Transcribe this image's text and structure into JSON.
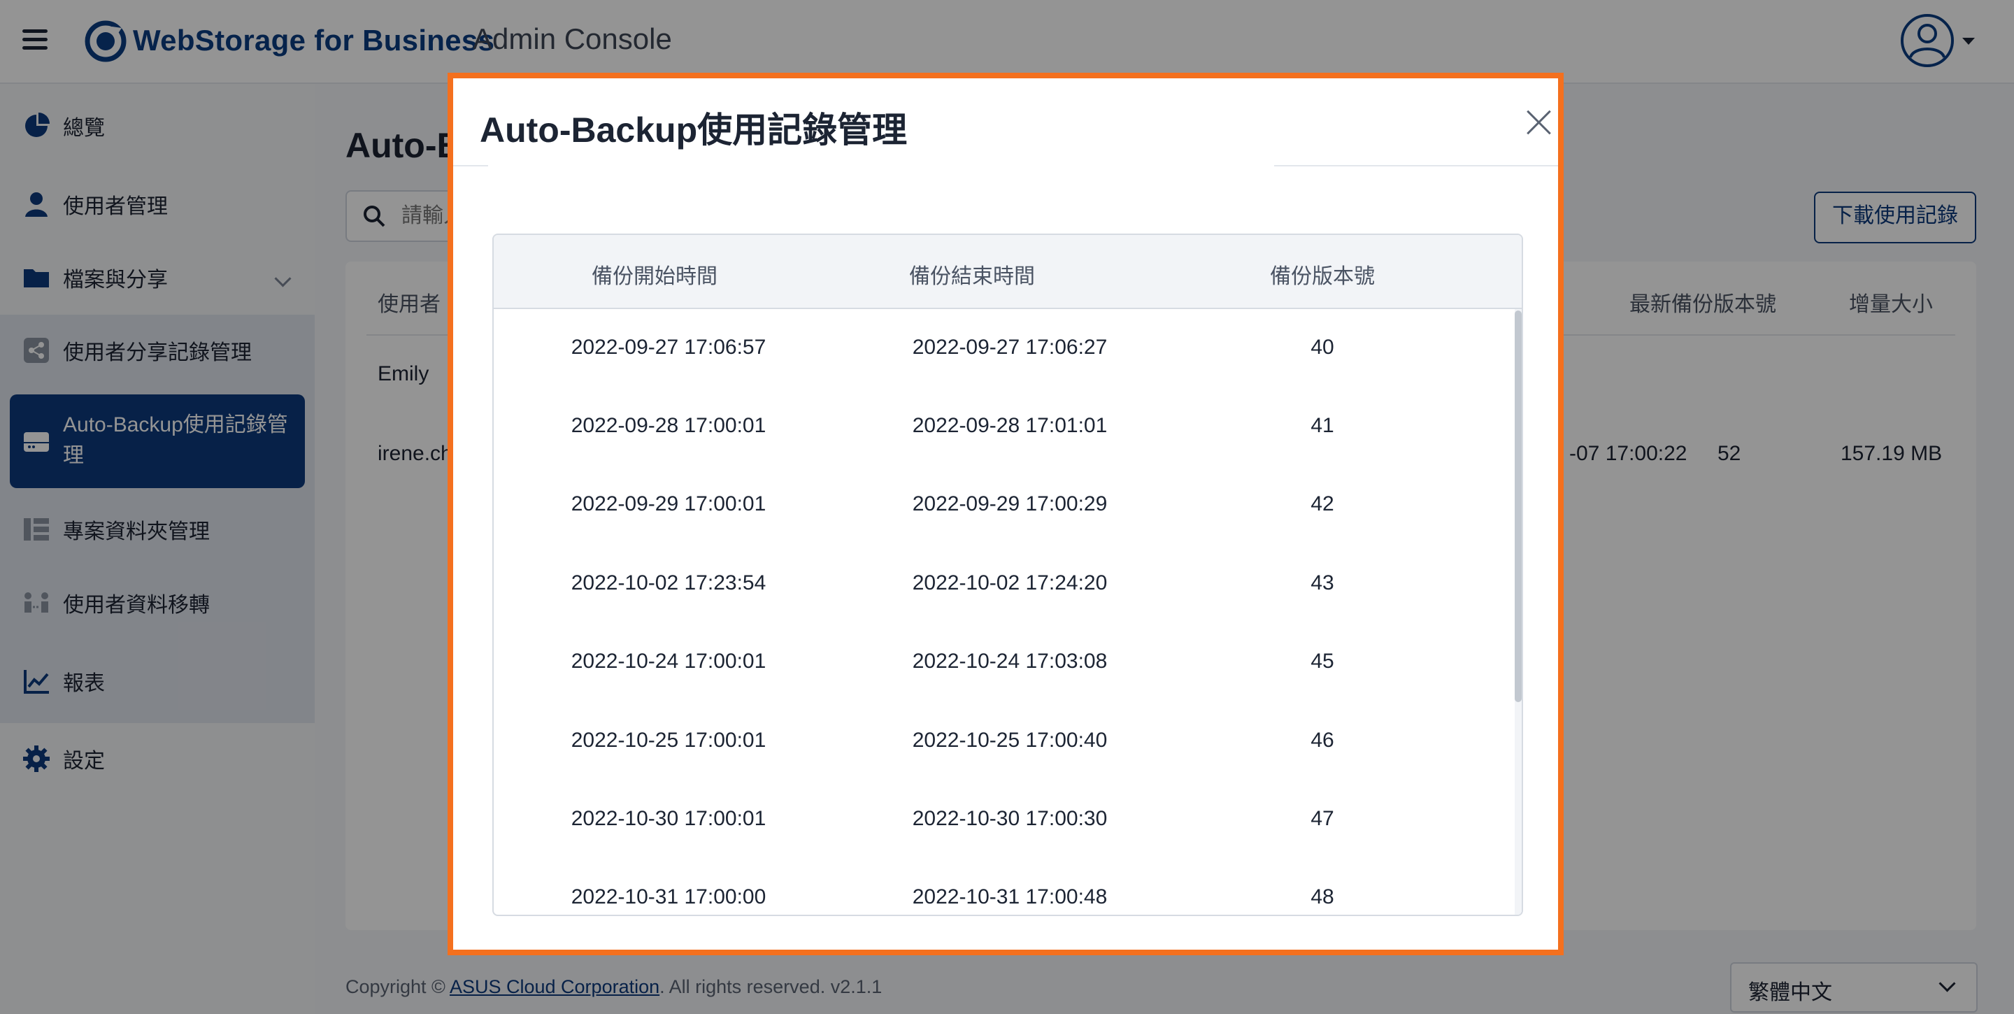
{
  "header": {
    "brand_name": "WebStorage for Business",
    "brand_sub": "Admin Console",
    "brand_color": "#0c3d82"
  },
  "sidebar": {
    "items": [
      {
        "label": "總覽",
        "icon": "pie-chart-icon"
      },
      {
        "label": "使用者管理",
        "icon": "user-icon"
      },
      {
        "label": "檔案與分享",
        "icon": "folder-icon"
      },
      {
        "label": "使用者分享記錄管理",
        "icon": "share-icon"
      },
      {
        "label": "Auto-Backup使用記錄管理",
        "icon": "backup-drive-icon",
        "active": true
      },
      {
        "label": "專案資料夾管理",
        "icon": "project-folder-icon"
      },
      {
        "label": "使用者資料移轉",
        "icon": "transfer-icon"
      },
      {
        "label": "報表",
        "icon": "line-chart-icon"
      },
      {
        "label": "設定",
        "icon": "gear-icon"
      }
    ],
    "active_color": "#0d3a7c"
  },
  "main": {
    "page_title": "Auto-Backup使用記錄管理",
    "search_placeholder": "請輸入",
    "download_button": "下載使用記錄",
    "table": {
      "headers": [
        "使用者",
        "最新備份版本號",
        "增量大小"
      ],
      "rows": [
        {
          "user": "Emily",
          "time": "",
          "version": "",
          "size": ""
        },
        {
          "user": "irene.ch",
          "time": "-07 17:00:22",
          "version": "52",
          "size": "157.19 MB"
        }
      ]
    }
  },
  "footer": {
    "copyright_prefix": "Copyright ©",
    "company": "ASUS Cloud Corporation",
    "copyright_suffix": ". All rights reserved. v2.1.1",
    "language": "繁體中文"
  },
  "modal": {
    "title": "Auto-Backup使用記錄管理",
    "border_color": "#f4701e",
    "columns": [
      "備份開始時間",
      "備份結束時間",
      "備份版本號"
    ],
    "rows": [
      {
        "start": "2022-09-27 17:06:57",
        "end": "2022-09-27 17:06:27",
        "version": "40"
      },
      {
        "start": "2022-09-28 17:00:01",
        "end": "2022-09-28 17:01:01",
        "version": "41"
      },
      {
        "start": "2022-09-29 17:00:01",
        "end": "2022-09-29 17:00:29",
        "version": "42"
      },
      {
        "start": "2022-10-02 17:23:54",
        "end": "2022-10-02 17:24:20",
        "version": "43"
      },
      {
        "start": "2022-10-24 17:00:01",
        "end": "2022-10-24 17:03:08",
        "version": "45"
      },
      {
        "start": "2022-10-25 17:00:01",
        "end": "2022-10-25 17:00:40",
        "version": "46"
      },
      {
        "start": "2022-10-30 17:00:01",
        "end": "2022-10-30 17:00:30",
        "version": "47"
      },
      {
        "start": "2022-10-31 17:00:00",
        "end": "2022-10-31 17:00:48",
        "version": "48"
      }
    ]
  }
}
